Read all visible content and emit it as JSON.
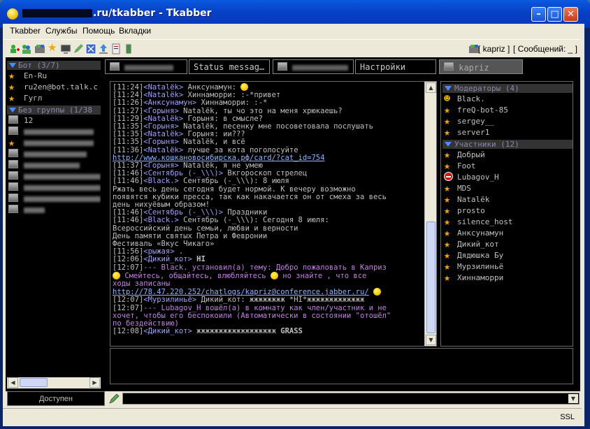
{
  "window": {
    "title_suffix": ".ru/tkabber - Tkabber"
  },
  "menu": {
    "items": [
      "Tkabber",
      "Службы",
      "Помощь",
      "Вкладки"
    ]
  },
  "toolbar": {
    "account": "[ kapriz ]",
    "messages": "[ Сообщений: _ ]"
  },
  "roster": {
    "groups": [
      {
        "label": "Бот (3/7)",
        "items": [
          "En-Ru",
          "ru2en@bot.talk.c",
          "Гугл"
        ]
      },
      {
        "label": "Без группы (1/38",
        "items": [
          "12"
        ]
      }
    ]
  },
  "tabs": {
    "items": [
      "",
      "Status messag…",
      "",
      "Настройки",
      "kapriz"
    ]
  },
  "chat": {
    "messages": [
      {
        "ts": "[11:24]",
        "nick": "<Natalёk>",
        "text": " Анксунамун: ",
        "emoticon": true
      },
      {
        "ts": "[11:24]",
        "nick": "<Natalёk>",
        "text": " Хиннаморри: :-*привет"
      },
      {
        "ts": "[11:26]",
        "nick": "<Анксунамун>",
        "text": " Хиннаморри: :-*"
      },
      {
        "ts": "[11:27]",
        "nick": "<Горыня>",
        "text": " Natalёk, ты чо это на меня хрюкаешь?"
      },
      {
        "ts": "[11:29]",
        "nick": "<Natalёk>",
        "text": " Горыня: в смысле?"
      },
      {
        "ts": "[11:35]",
        "nick": "<Горыня>",
        "text": " Natalёk, песенку мне посоветовала послушать"
      },
      {
        "ts": "[11:35]",
        "nick": "<Natalёk>",
        "text": " Горыня: ии???"
      },
      {
        "ts": "[11:35]",
        "nick": "<Горыня>",
        "text": " Natalёk, и всё"
      },
      {
        "ts": "[11:36]",
        "nick": "<Natalёk>",
        "text": " лучше за кота поголосуйте"
      },
      {
        "link": "http://www.кошкановосибирска.рф/card/?cat_id=754"
      },
      {
        "ts": "[11:37]",
        "nick": "<Горыня>",
        "text": " Natalёk, я не умею"
      },
      {
        "ts": "[11:46]",
        "nick": "<Сентябрь (-_\\\\\\)>",
        "text": " Вкгороскоп стрелец"
      },
      {
        "ts": "[11:46]",
        "nick": "<Black.>",
        "text": " Сентябрь (-_\\\\\\): 8 июля"
      },
      {
        "plain": "Ржать весь день сегодня будет нормой. К вечеру возможно"
      },
      {
        "plain": "появятся кубики пресса, так как накачается он от смеха за весь"
      },
      {
        "plain": "день нихуёвым образом!"
      },
      {
        "ts": "[11:46]",
        "nick": "<Сентябрь (-_\\\\\\)>",
        "text": " Праздники"
      },
      {
        "ts": "[11:46]",
        "nick": "<Black.>",
        "text": " Сентябрь (-_\\\\\\): Сегодня 8 июля:"
      },
      {
        "plain": "Всероссийский день семьи, любви и верности"
      },
      {
        "plain": "День памяти святых Петра и Февронии"
      },
      {
        "plain": "Фестиваль «Вкус Чикаго»"
      },
      {
        "ts": "[11:56]",
        "nick": "<рыжая>",
        "text": " ."
      },
      {
        "ts": "[12:06]",
        "nick": "<Дикий_кот>",
        "text": " HI",
        "bold": true
      },
      {
        "ts": "[12:07]",
        "sys": "--- Black. установил(а) тему: Добро пожаловать в Каприз"
      },
      {
        "sys_smile": " Смейтесь, общайтесь, влюбляйтесь ",
        "sys_smile2": " но знайте , что все"
      },
      {
        "sys": "ходы записаны"
      },
      {
        "link": "http://78.47.220.252/chatlogs/kapriz@conference.jabber.ru/",
        "smile_after": true
      },
      {
        "ts": "[12:07]",
        "nick": "<Мурзилиньё>",
        "text": " Дикий_кот: жжжжжжжж *HI*жжжжжжжжжжжжж"
      },
      {
        "ts": "[12:07]",
        "sys": "--- Lubagov_H вошёл(а) в комнату как член/участник и не"
      },
      {
        "sys": "хочет, чтобы его беспокоили (Автоматически в состоянии \"отошёл\""
      },
      {
        "sys": "по бездействию)"
      },
      {
        "ts": "[12:08]",
        "nick": "<Дикий_кот>",
        "text": " жжжжжжжжжжжжжжжжжж GRASS",
        "bold_tail": true
      }
    ]
  },
  "users": {
    "moderators_label": "Модераторы (4)",
    "moderators": [
      "Black.",
      "freQ-bot-85",
      "sergey__",
      "server1"
    ],
    "participants_label": "Участники (12)",
    "participants": [
      "Добрый",
      "Foot",
      "Lubagov_H",
      "MDS",
      "Natalёk",
      "prosto",
      "silence_host",
      "Анксунамун",
      "Дикий_кот",
      "Дядюшка Бу",
      "Мурзилиньё",
      "Хиннаморри"
    ]
  },
  "bottom": {
    "status": "Доступен"
  },
  "statusbar": {
    "ssl": "SSL"
  }
}
